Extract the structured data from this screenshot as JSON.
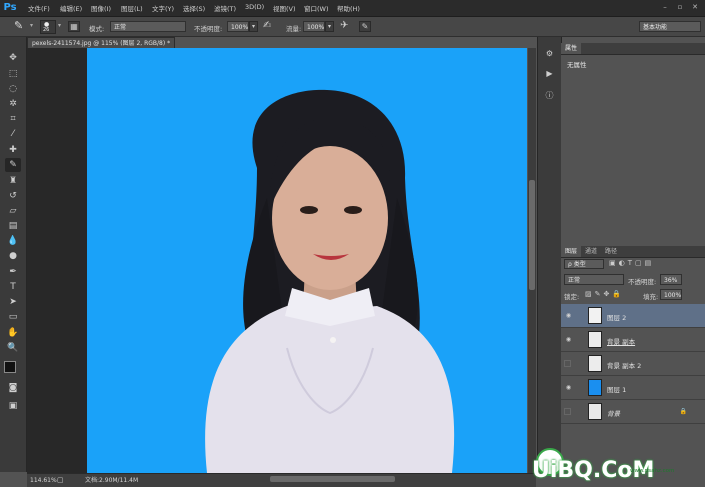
{
  "app": {
    "logo": "Ps"
  },
  "menu": [
    "文件(F)",
    "编辑(E)",
    "图像(I)",
    "图层(L)",
    "文字(Y)",
    "选择(S)",
    "滤镜(T)",
    "3D(D)",
    "视图(V)",
    "窗口(W)",
    "帮助(H)"
  ],
  "options": {
    "brush_size": "26",
    "mode_label": "模式:",
    "mode_value": "正常",
    "opacity_label": "不透明度:",
    "opacity_value": "100%",
    "flow_label": "流量:",
    "flow_value": "100%",
    "workspace": "基本功能"
  },
  "document": {
    "tab_title": "pexels-2411574.jpg @ 115% (图层 2, RGB/8) *",
    "zoom": "114.61%",
    "doc_size": "文档:2.90M/11.4M",
    "canvas_color": "#1aa2f9"
  },
  "properties": {
    "tab": "属性",
    "content": "无属性"
  },
  "layers_panel": {
    "tabs": [
      "图层",
      "通道",
      "路径"
    ],
    "filter": "ρ 类型",
    "blend_mode": "正常",
    "opacity_label": "不透明度:",
    "opacity_value": "36%",
    "lock_label": "锁定:",
    "fill_label": "填充:",
    "fill_value": "100%",
    "layers": [
      {
        "name": "图层 2",
        "visible": true,
        "selected": true,
        "thumb": "portrait"
      },
      {
        "name": "背景 副本",
        "visible": true,
        "selected": false,
        "thumb": "portrait"
      },
      {
        "name": "背景 副本 2",
        "visible": false,
        "selected": false,
        "thumb": "portrait"
      },
      {
        "name": "图层 1",
        "visible": true,
        "selected": false,
        "thumb": "blue"
      },
      {
        "name": "背景",
        "visible": false,
        "selected": false,
        "thumb": "portrait",
        "locked": true
      }
    ]
  },
  "watermark": {
    "brand": "UiBQ.CoM",
    "sub": "www.psahz.com"
  }
}
